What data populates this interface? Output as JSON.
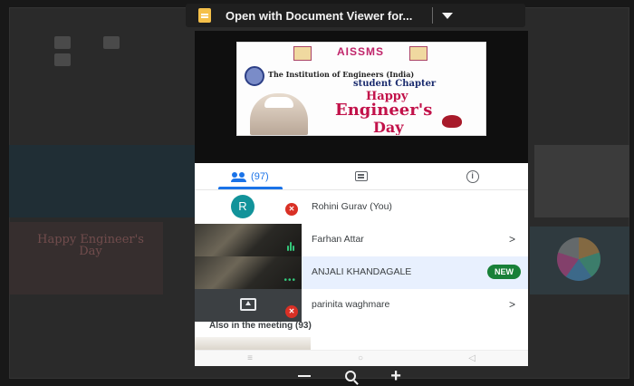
{
  "banner": {
    "title": "Open with Document Viewer for...",
    "icon": "document-icon",
    "menu_icon": "chevron-down-icon"
  },
  "poster": {
    "org": "AISSMS",
    "institution": "The Institution of Engineers (India)",
    "chapter": "student Chapter",
    "line1": "Happy",
    "line2": "Engineer's",
    "line3": "Day"
  },
  "tabs": [
    {
      "label": "(97)",
      "icon": "people-icon",
      "active": true
    },
    {
      "label": "",
      "icon": "chat-icon",
      "active": false
    },
    {
      "label": "i",
      "icon": "info-icon",
      "active": false
    }
  ],
  "participants": [
    {
      "avatar_letter": "R",
      "name": "Rohini Gurav (You)",
      "muted": true,
      "chevron": ""
    },
    {
      "name": "Farhan Attar",
      "chevron": ">"
    },
    {
      "name": "ANJALI KHANDAGALE",
      "badge": "NEW",
      "chevron": ""
    },
    {
      "name": "parinita waghmare",
      "muted": true,
      "chevron": ">"
    }
  ],
  "also_in_meeting": "Also in the meeting (93)",
  "background": {
    "poster_text": "Happy Engineer's Day"
  },
  "colors": {
    "accent": "#1a73e8",
    "badge_new": "#188038",
    "avatar": "#12939a",
    "mute": "#d93025",
    "highlight": "#e8f0fe"
  }
}
